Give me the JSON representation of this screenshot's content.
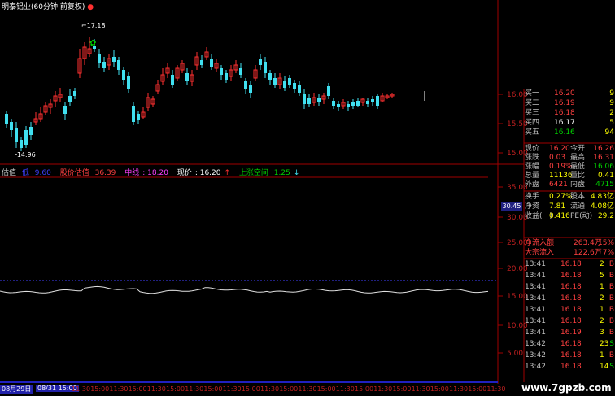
{
  "title": "明泰铝业(60分钟 前复权)",
  "title_icon": "pin-icon",
  "price_high_label": "17.18",
  "price_low_label": "14.96",
  "indicator_bar": {
    "name": "估值",
    "items": [
      {
        "label": "低",
        "value": "9.60",
        "color": "#4040ff"
      },
      {
        "label": "股价估值",
        "value": "36.39",
        "color": "#ff4040"
      },
      {
        "label": "中线",
        "value": "18.20",
        "color": "#ff40ff"
      },
      {
        "label": "现价",
        "value": "16.20",
        "color": "#ffffff"
      },
      {
        "label": "上涨空间",
        "value": "1.25",
        "color": "#00d000"
      }
    ]
  },
  "top_axis_labels": [
    "16.00",
    "15.50",
    "15.00"
  ],
  "bottom_axis_labels": [
    "35.00",
    "30.00",
    "25.00",
    "20.00",
    "15.00",
    "10.00",
    "5.00"
  ],
  "marker_value": "30.45",
  "order_book": [
    {
      "label": "买一",
      "price": "16.20",
      "vol": "9"
    },
    {
      "label": "买二",
      "price": "16.19",
      "vol": "9"
    },
    {
      "label": "买三",
      "price": "16.18",
      "vol": "2"
    },
    {
      "label": "买四",
      "price": "16.17",
      "vol": "5"
    },
    {
      "label": "买五",
      "price": "16.16",
      "vol": "94"
    }
  ],
  "quote": [
    {
      "l1": "现价",
      "v1": "16.20",
      "l2": "今开",
      "v2": "16.26",
      "c1": "#ff4040",
      "c2": "#ff4040"
    },
    {
      "l1": "涨跌",
      "v1": "0.03",
      "l2": "最高",
      "v2": "16.31",
      "c1": "#ff4040",
      "c2": "#ff4040"
    },
    {
      "l1": "涨幅",
      "v1": "0.19%",
      "l2": "最低",
      "v2": "16.06",
      "c1": "#ff4040",
      "c2": "#00d000"
    },
    {
      "l1": "总量",
      "v1": "11136",
      "l2": "量比",
      "v2": "0.41",
      "c1": "#ffff00",
      "c2": "#ffff00"
    },
    {
      "l1": "外盘",
      "v1": "6421",
      "l2": "内盘",
      "v2": "4715",
      "c1": "#ff4040",
      "c2": "#00d000"
    }
  ],
  "fundamentals": [
    {
      "l1": "换手",
      "v1": "0.27%",
      "l2": "股本",
      "v2": "4.83亿"
    },
    {
      "l1": "净资",
      "v1": "7.81",
      "l2": "流通",
      "v2": "4.08亿"
    },
    {
      "l1": "收益(一)",
      "v1": "0.416",
      "l2": "PE(动)",
      "v2": "29.2"
    }
  ],
  "flows": [
    {
      "label": "净流入额",
      "value": "263.4万",
      "pct": "15%"
    },
    {
      "label": "大宗流入",
      "value": "122.6万",
      "pct": "7%"
    }
  ],
  "trades": [
    {
      "time": "13:41",
      "price": "16.18",
      "vol": "2",
      "side": "B"
    },
    {
      "time": "13:41",
      "price": "16.18",
      "vol": "5",
      "side": "B"
    },
    {
      "time": "13:41",
      "price": "16.18",
      "vol": "1",
      "side": "B"
    },
    {
      "time": "13:41",
      "price": "16.18",
      "vol": "2",
      "side": "B"
    },
    {
      "time": "13:41",
      "price": "16.18",
      "vol": "1",
      "side": "B"
    },
    {
      "time": "13:41",
      "price": "16.18",
      "vol": "2",
      "side": "B"
    },
    {
      "time": "13:41",
      "price": "16.19",
      "vol": "3",
      "side": "B"
    },
    {
      "time": "13:42",
      "price": "16.18",
      "vol": "23",
      "side": "S"
    },
    {
      "time": "13:42",
      "price": "16.18",
      "vol": "1",
      "side": "B"
    },
    {
      "time": "13:42",
      "price": "16.18",
      "vol": "14",
      "side": "S"
    }
  ],
  "time_axis": {
    "dates": [
      "08月29日",
      "08/31 15:00"
    ],
    "ticks": [
      "11:30",
      "15:00",
      "11:30",
      "15:00",
      "11:30",
      "15:00",
      "11:30",
      "15:00",
      "11:30",
      "15:00",
      "11:30",
      "15:00",
      "11:30",
      "15:00",
      "11:30",
      "15:00",
      "11:30",
      "15:00",
      "11:30",
      "15:00",
      "11:30",
      "15:00",
      "11:30"
    ]
  },
  "watermark": "www.7gpzb.com",
  "colors": {
    "up": "#ff3030",
    "down": "#40e0f0",
    "grid": "#a00000",
    "axis_text": "#c02020"
  }
}
